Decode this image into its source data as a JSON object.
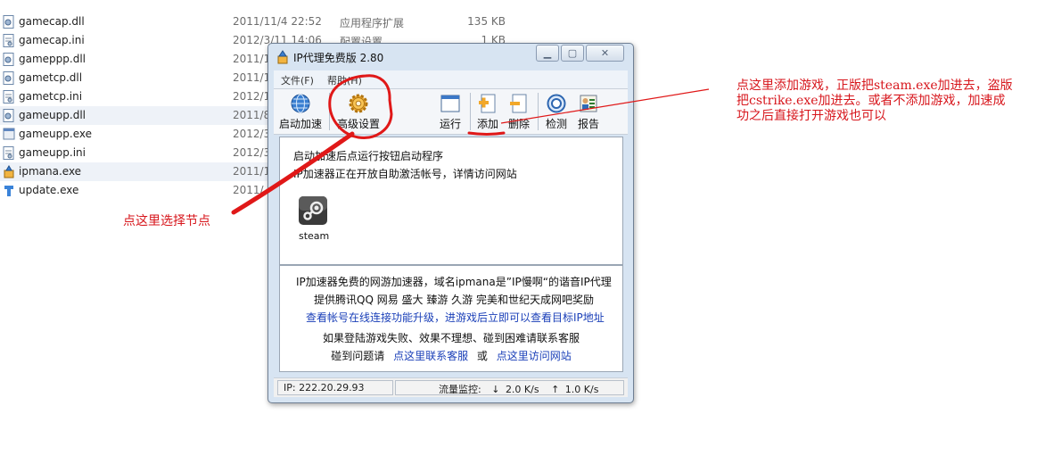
{
  "explorer": {
    "top_partial": [
      "",
      "",
      ""
    ],
    "files": [
      {
        "name": "gamecap.dll",
        "date": "2011/11/4 22:52",
        "type": "应用程序扩展",
        "size": "135 KB",
        "icon": "dll-icon"
      },
      {
        "name": "gamecap.ini",
        "date": "2012/3/11 14:06",
        "type": "配置设置",
        "size": "1 KB",
        "icon": "ini-icon"
      },
      {
        "name": "gameppp.dll",
        "date": "2011/1",
        "type": "",
        "size": "",
        "icon": "dll-icon"
      },
      {
        "name": "gametcp.dll",
        "date": "2011/1",
        "type": "",
        "size": "",
        "icon": "dll-icon"
      },
      {
        "name": "gametcp.ini",
        "date": "2012/1",
        "type": "",
        "size": "",
        "icon": "ini-icon"
      },
      {
        "name": "gameupp.dll",
        "date": "2011/8",
        "type": "",
        "size": "",
        "icon": "dll-icon"
      },
      {
        "name": "gameupp.exe",
        "date": "2012/3",
        "type": "",
        "size": "",
        "icon": "exe-icon"
      },
      {
        "name": "gameupp.ini",
        "date": "2012/3",
        "type": "",
        "size": "",
        "icon": "ini-icon"
      },
      {
        "name": "ipmana.exe",
        "date": "2011/1",
        "type": "",
        "size": "",
        "icon": "ipmana-icon"
      },
      {
        "name": "update.exe",
        "date": "2011/",
        "type": "",
        "size": "",
        "icon": "update-icon"
      }
    ]
  },
  "dialog": {
    "title": "IP代理免费版 2.80",
    "menu": {
      "file": "文件(F)",
      "help": "帮助(H)"
    },
    "toolbar": {
      "start": "启动加速",
      "advanced": "高级设置",
      "run": "运行",
      "add": "添加",
      "delete": "删除",
      "detect": "检测",
      "report": "报告"
    },
    "top_pane": {
      "line1": "启动加速后点运行按钮启动程序",
      "line2": "IP加速器正在开放自助激活帐号，详情访问网站",
      "game_label": "steam"
    },
    "bottom_pane": {
      "line1": "IP加速器免费的网游加速器，域名ipmana是”IP慢啊“的谐音IP代理",
      "line2": "提供腾讯QQ 网易 盛大 臻游 久游 完美和世纪天成网吧奖励",
      "line3_link": "查看帐号在线连接功能升级，进游戏后立即可以查看目标IP地址",
      "line4": "如果登陆游戏失败、效果不理想、碰到困难请联系客服",
      "line5_prefix": "碰到问题请",
      "line5_link1": "点这里联系客服",
      "line5_or": "或",
      "line5_link2": "点这里访问网站"
    },
    "status": {
      "ip": "IP: 222.20.29.93",
      "traffic_label": "流量监控:",
      "down": "2.0 K/s",
      "up": "1.0 K/s"
    }
  },
  "annotations": {
    "node_hint": "点这里选择节点",
    "add_hint_l1": "点这里添加游戏，正版把steam.exe加进去，盗版",
    "add_hint_l2": "把cstrike.exe加进去。或者不添加游戏，加速成",
    "add_hint_l3": "功之后直接打开游戏也可以",
    "color": "#d7161c"
  }
}
